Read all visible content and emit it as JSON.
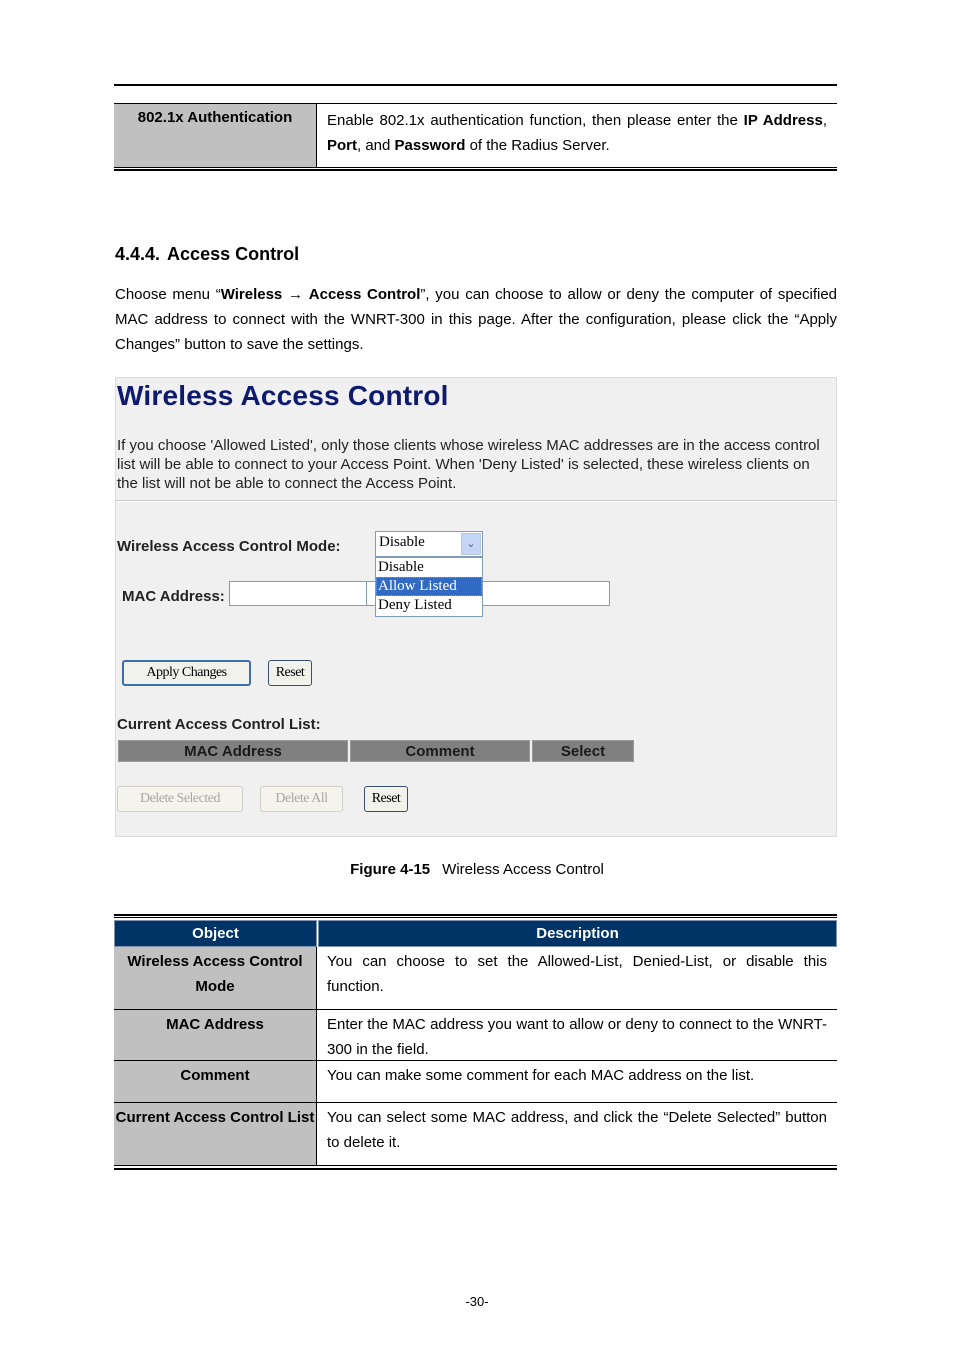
{
  "auth_table": {
    "object": "802.1x Authentication",
    "description_parts": {
      "p1": "Enable 802.1x authentication function, then please enter the ",
      "b1": "IP Address",
      "p2": ", ",
      "b2": "Port",
      "p3": ", and ",
      "b3": "Password",
      "p4": " of the Radius Server."
    }
  },
  "section": {
    "number": "4.4.4.",
    "title": "Access Control",
    "intro": {
      "p1": "Choose menu “",
      "b1": "Wireless",
      "arrow": "→",
      "b2": "Access Control",
      "p2": "”, you can choose to allow or deny the computer of specified MAC address to connect with the WNRT-300 in this page. After the configuration, please click the “Apply Changes” button to save the settings."
    }
  },
  "screenshot": {
    "title": "Wireless Access Control",
    "description": "If you choose 'Allowed Listed', only those clients whose wireless MAC addresses are in the access control list will be able to connect to your Access Point. When 'Deny Listed' is selected, these wireless clients on the list will not be able to connect the Access Point.",
    "mode_label": "Wireless Access Control Mode:",
    "mode_value": "Disable",
    "mode_options": [
      "Disable",
      "Allow Listed",
      "Deny Listed"
    ],
    "mode_highlighted": "Allow Listed",
    "mac_label": "MAC Address:",
    "mac_value": "",
    "comment_value": "",
    "apply_button": "Apply Changes",
    "reset_button": "Reset",
    "list_label": "Current Access Control List:",
    "list_columns": [
      "MAC Address",
      "Comment",
      "Select"
    ],
    "delete_selected_button": "Delete Selected",
    "delete_all_button": "Delete All",
    "list_reset_button": "Reset"
  },
  "caption": {
    "label": "Figure 4-15",
    "text": "Wireless Access Control"
  },
  "desc_table": {
    "headers": [
      "Object",
      "Description"
    ],
    "rows": [
      {
        "object": "Wireless Access Control Mode",
        "description": "You can choose to set the Allowed-List, Denied-List, or disable this function."
      },
      {
        "object": "MAC Address",
        "description": "Enter the MAC address you want to allow or deny to connect to the WNRT-300 in the field."
      },
      {
        "object": "Comment",
        "description": "You can make some comment for each MAC address on the list."
      },
      {
        "object": "Current Access Control List",
        "description": "You can select some MAC address, and click the “Delete Selected” button to delete it."
      }
    ]
  },
  "page_number": "-30-",
  "colors": {
    "title_blue": "#0d1a6e",
    "table_header": "#003366",
    "object_cell": "#c0c0c0",
    "selected_option": "#316ac5",
    "list_header": "#808080"
  }
}
